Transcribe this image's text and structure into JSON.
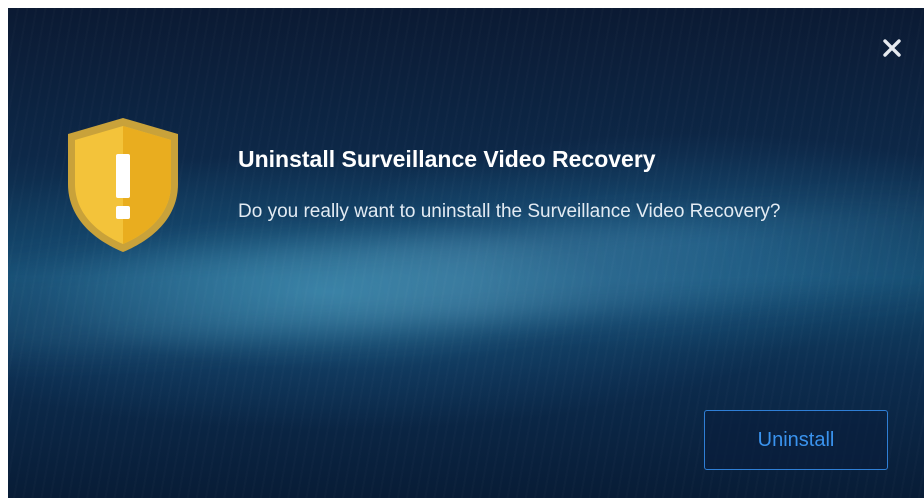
{
  "dialog": {
    "title": "Uninstall Surveillance Video Recovery",
    "message": "Do you really want to uninstall the Surveillance Video Recovery?",
    "uninstall_label": "Uninstall",
    "close_icon": "close-icon",
    "warning_icon": "shield-warning-icon"
  },
  "colors": {
    "accent": "#2f7fd6",
    "button_text": "#3a93ee",
    "shield": "#f5c53a"
  }
}
